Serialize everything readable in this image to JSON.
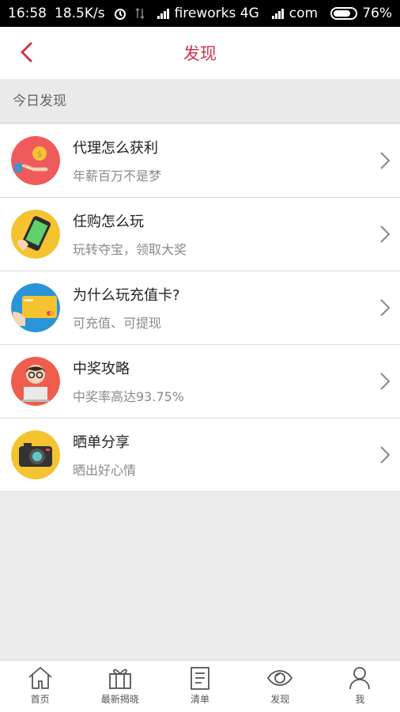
{
  "status_bar": {
    "time": "16:58",
    "speed": "18.5K/s",
    "carrier1": "fireworks 4G",
    "carrier2": "com",
    "battery": "76%"
  },
  "header": {
    "title": "发现"
  },
  "section": {
    "label": "今日发现"
  },
  "items": [
    {
      "title": "代理怎么获利",
      "subtitle": "年薪百万不是梦",
      "icon": "hand-coin-icon"
    },
    {
      "title": "任购怎么玩",
      "subtitle": "玩转夺宝，领取大奖",
      "icon": "phone-icon"
    },
    {
      "title": "为什么玩充值卡?",
      "subtitle": "可充值、可提现",
      "icon": "card-icon"
    },
    {
      "title": "中奖攻略",
      "subtitle": "中奖率高达93.75%",
      "icon": "person-laptop-icon"
    },
    {
      "title": "晒单分享",
      "subtitle": "晒出好心情",
      "icon": "camera-icon"
    }
  ],
  "bottom_nav": [
    {
      "label": "首页",
      "icon": "home-icon"
    },
    {
      "label": "最新揭晓",
      "icon": "gift-icon"
    },
    {
      "label": "清单",
      "icon": "list-icon"
    },
    {
      "label": "发现",
      "icon": "eye-icon"
    },
    {
      "label": "我",
      "icon": "user-icon"
    }
  ],
  "colors": {
    "accent": "#d3334d",
    "background": "#ececec"
  }
}
